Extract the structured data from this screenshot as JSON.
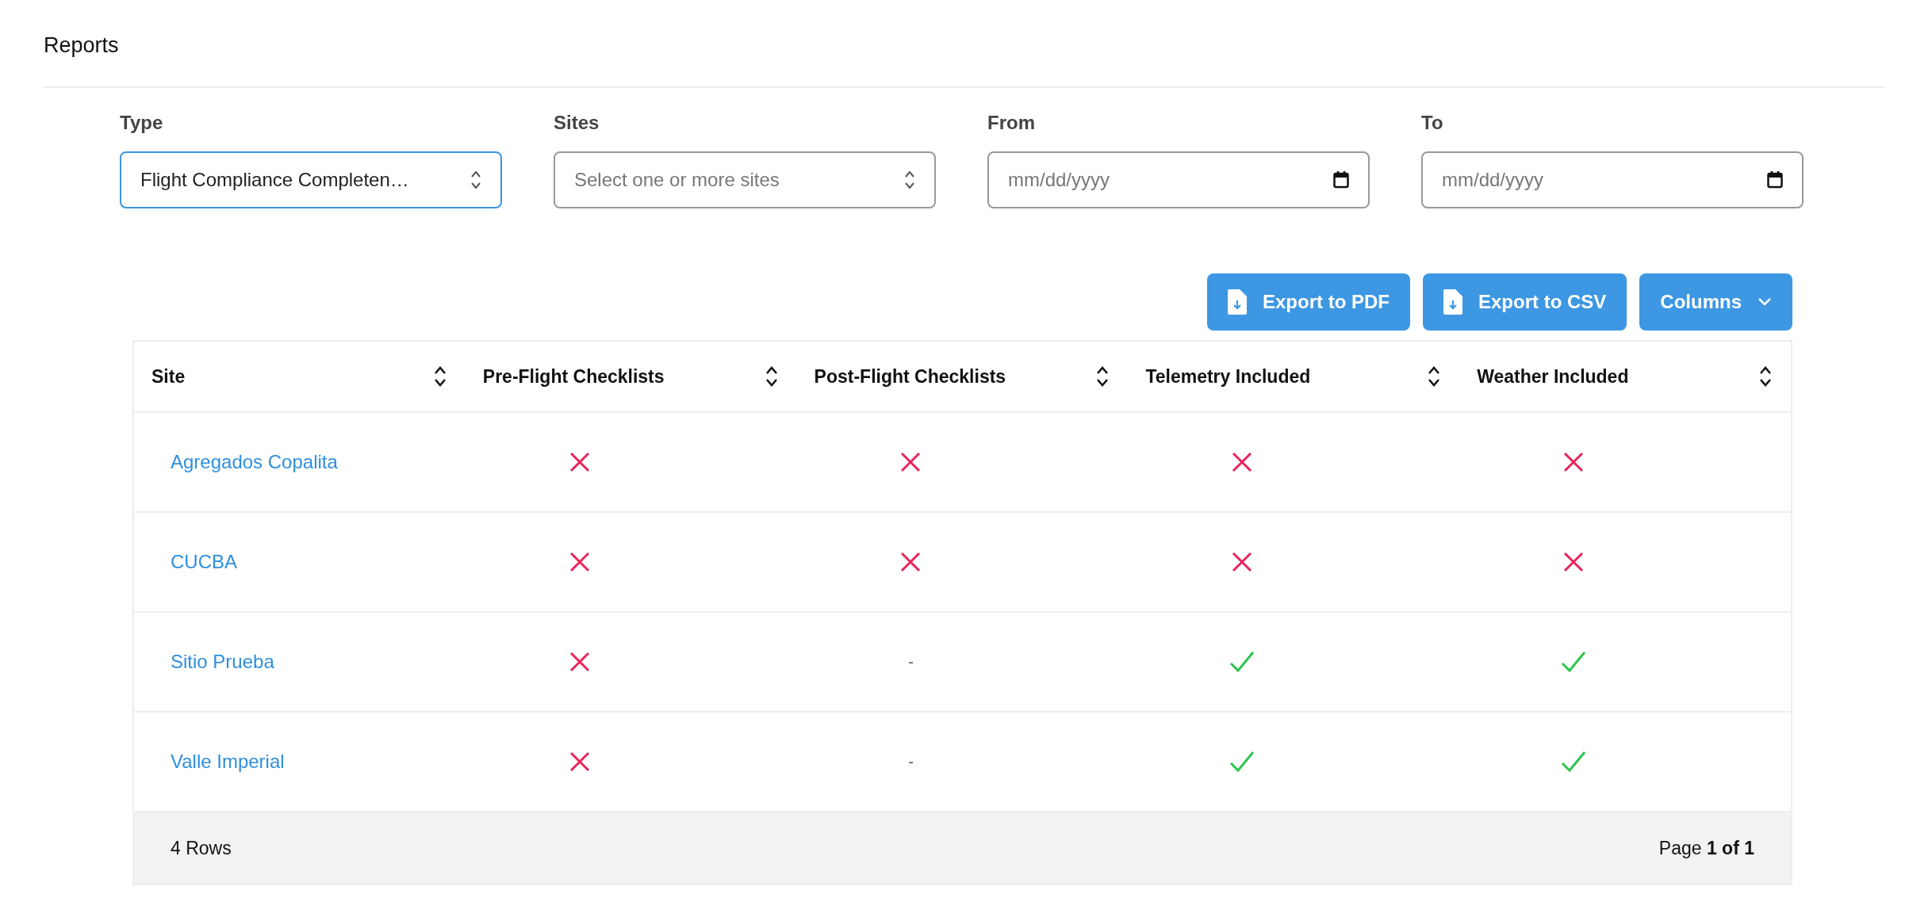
{
  "page": {
    "title": "Reports"
  },
  "filters": [
    {
      "label": "Type",
      "kind": "select",
      "value": "Flight Compliance Completen…",
      "focused": true
    },
    {
      "label": "Sites",
      "kind": "select",
      "placeholder": "Select one or more sites",
      "focused": false
    },
    {
      "label": "From",
      "kind": "date",
      "placeholder": "mm/dd/yyyy",
      "focused": false
    },
    {
      "label": "To",
      "kind": "date",
      "placeholder": "mm/dd/yyyy",
      "focused": false
    }
  ],
  "actions": [
    {
      "label": "Export to PDF",
      "kind": "export"
    },
    {
      "label": "Export to CSV",
      "kind": "export"
    },
    {
      "label": "Columns",
      "kind": "dropdown"
    }
  ],
  "table": {
    "columns": [
      "Site",
      "Pre-Flight Checklists",
      "Post-Flight Checklists",
      "Telemetry Included",
      "Weather Included"
    ],
    "rows": [
      {
        "site": "Agregados Copalita",
        "cells": [
          {
            "kind": "cross"
          },
          {
            "kind": "cross"
          },
          {
            "kind": "cross"
          },
          {
            "kind": "cross"
          }
        ]
      },
      {
        "site": "CUCBA",
        "cells": [
          {
            "kind": "cross"
          },
          {
            "kind": "cross"
          },
          {
            "kind": "cross"
          },
          {
            "kind": "cross"
          }
        ]
      },
      {
        "site": "Sitio Prueba",
        "cells": [
          {
            "kind": "cross"
          },
          {
            "kind": "text",
            "text": "-"
          },
          {
            "kind": "check"
          },
          {
            "kind": "check"
          }
        ]
      },
      {
        "site": "Valle Imperial",
        "cells": [
          {
            "kind": "cross"
          },
          {
            "kind": "text",
            "text": "-"
          },
          {
            "kind": "check"
          },
          {
            "kind": "check"
          }
        ]
      }
    ],
    "footer": {
      "count": "4 Rows",
      "page": "Page **1 of 1**"
    }
  }
}
